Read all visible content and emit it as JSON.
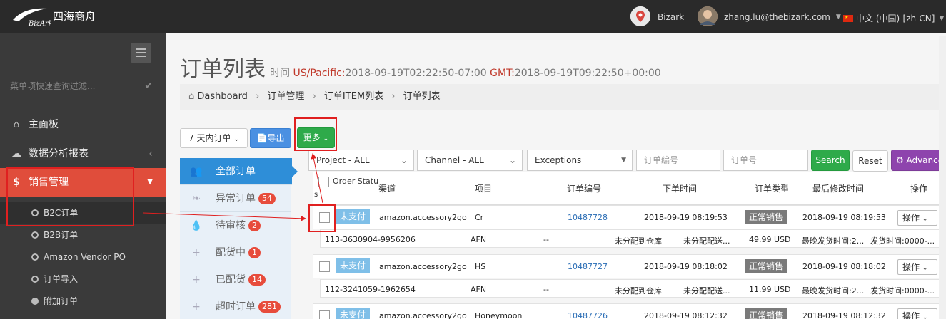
{
  "topbar": {
    "brand": "四海商舟",
    "logo_text": "BizArk",
    "account_name": "Bizark",
    "user_email": "zhang.lu@thebizark.com",
    "language": "中文 (中国)-[zh-CN]"
  },
  "sidebar": {
    "filter_placeholder": "菜单项快速查询过滤...",
    "items": [
      {
        "label": "主面板",
        "icon": "home-icon"
      },
      {
        "label": "数据分析报表",
        "icon": "cloud-icon"
      },
      {
        "label": "销售管理",
        "icon": "dollar-icon"
      }
    ],
    "sub_items": [
      {
        "label": "B2C订单"
      },
      {
        "label": "B2B订单"
      },
      {
        "label": "Amazon Vendor PO"
      },
      {
        "label": "订单导入"
      },
      {
        "label": "附加订单"
      }
    ]
  },
  "header": {
    "title": "订单列表",
    "time_label": "时间",
    "tz1": "US/Pacific:",
    "time1": "2018-09-19T02:22:50-07:00",
    "tz2": "GMT:",
    "time2": "2018-09-19T09:22:50+00:00"
  },
  "breadcrumb": [
    "Dashboard",
    "订单管理",
    "订单ITEM列表",
    "订单列表"
  ],
  "toolbar": {
    "range_select": "7 天内订单",
    "export_label": "导出",
    "more_label": "更多"
  },
  "filters": {
    "project": "Project - ALL",
    "channel": "Channel - ALL",
    "exceptions": "Exceptions",
    "order_no_placeholder": "订单编号",
    "order_id_placeholder": "订单号",
    "search_label": "Search",
    "reset_label": "Reset",
    "advance_label": "Advance"
  },
  "status_list": [
    {
      "label": "全部订单",
      "count": ""
    },
    {
      "label": "异常订单",
      "count": "54"
    },
    {
      "label": "待审核",
      "count": "2"
    },
    {
      "label": "配货中",
      "count": "1"
    },
    {
      "label": "已配货",
      "count": "14"
    },
    {
      "label": "超时订单",
      "count": "281"
    }
  ],
  "table": {
    "headers": {
      "status": "Order Statu",
      "status_wrap": "s",
      "channel": "渠道",
      "project": "项目",
      "order_no": "订单编号",
      "order_time": "下单时间",
      "order_type": "订单类型",
      "modified": "最后修改时间",
      "action": "操作"
    },
    "rows": [
      {
        "status": "未支付",
        "channel": "amazon.accessory2go",
        "project": "Cr",
        "order_no": "10487728",
        "order_time": "2018-09-19 08:19:53",
        "type": "正常销售",
        "modified": "2018-09-19 08:19:53",
        "action": "操作",
        "sub": {
          "amazon_id": "113-3630904-9956206",
          "fulfil": "AFN",
          "dash": "--",
          "warehouse": "未分配到仓库",
          "shipping": "未分配配送...",
          "amount": "49.99 USD",
          "latest_ship": "最晚发货时间:2...",
          "ship_time": "发货时间:0000-..."
        }
      },
      {
        "status": "未支付",
        "channel": "amazon.accessory2go",
        "project": "HS",
        "order_no": "10487727",
        "order_time": "2018-09-19 08:18:02",
        "type": "正常销售",
        "modified": "2018-09-19 08:18:02",
        "action": "操作",
        "sub": {
          "amazon_id": "112-3241059-1962654",
          "fulfil": "AFN",
          "dash": "--",
          "warehouse": "未分配到仓库",
          "shipping": "未分配配送...",
          "amount": "11.99 USD",
          "latest_ship": "最晚发货时间:2...",
          "ship_time": "发货时间:0000-..."
        }
      },
      {
        "status": "未支付",
        "channel": "amazon.accessory2go",
        "project": "Honeymoon",
        "order_no": "10487726",
        "order_time": "2018-09-19 08:12:32",
        "type": "正常销售",
        "modified": "2018-09-19 08:12:32",
        "action": "操作"
      }
    ]
  }
}
